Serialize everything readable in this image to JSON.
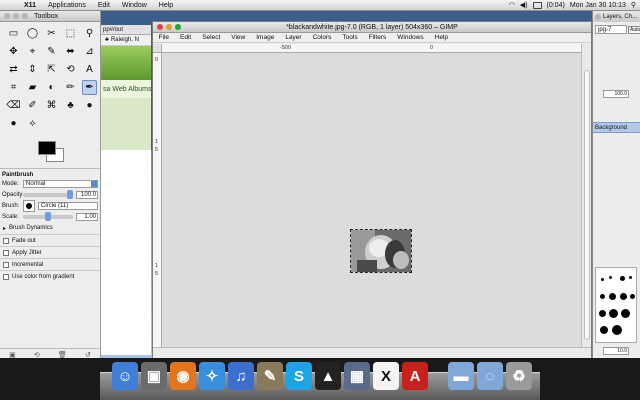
{
  "menubar": {
    "apple": "",
    "app": "X11",
    "items": [
      "Applications",
      "Edit",
      "Window",
      "Help"
    ],
    "clock": "Mon Jan 30  10:13",
    "battery": "(0:04)"
  },
  "toolbox": {
    "title": "Toolbox",
    "tools": [
      "▭",
      "◯",
      "✂",
      "⬚",
      "⚲",
      "✥",
      "⌖",
      "✎",
      "⬌",
      "⊿",
      "⇄",
      "⇕",
      "⇱",
      "⟲",
      "A",
      "⌗",
      "▰",
      "◐",
      "✏",
      "✒",
      "⌫",
      "✐",
      "⌘",
      "♣",
      "●",
      "●",
      "⟡"
    ],
    "options_title": "Paintbrush",
    "mode_label": "Mode:",
    "mode_value": "Normal",
    "opacity_label": "Opacity",
    "opacity_value": "100.0",
    "opacity_level": 1.0,
    "brush_label": "Brush:",
    "brush_value": "Circle (11)",
    "scale_label": "Scale:",
    "scale_value": "1.00",
    "scale_level": 0.5,
    "dynamics_label": "Brush Dynamics",
    "fade_label": "Fade out",
    "jitter_label": "Apply Jitter",
    "incremental_label": "Incremental",
    "gradient_label": "Use color from gradient"
  },
  "browser": {
    "url": "pp#/out",
    "bookmark": "Raleigh, N",
    "album_text": "sa Web Albums"
  },
  "picnik_title": "Picnik",
  "gimp": {
    "title": "*blackandwhite.jpg-7.0 (RGB, 1 layer) 504x360 – GIMP",
    "menu": [
      "File",
      "Edit",
      "Select",
      "View",
      "Image",
      "Layer",
      "Colors",
      "Tools",
      "Filters",
      "Windows",
      "Help"
    ],
    "ruler_top": [
      "-500",
      "0"
    ],
    "ruler_left": [
      "0",
      "1",
      "5",
      "1",
      "5"
    ]
  },
  "rpanel": {
    "title": "Layers, Ch...",
    "combo": "jpg-7",
    "auto": "Auto",
    "opacity_value": "100.0",
    "layer_name": "Background",
    "spacing_value": "10.0"
  },
  "dock": {
    "icons": [
      {
        "name": "finder",
        "glyph": "☺",
        "color": "#3f7fd6"
      },
      {
        "name": "photos",
        "glyph": "▣",
        "color": "#6b6b6b"
      },
      {
        "name": "firefox",
        "glyph": "◉",
        "color": "#e5751c"
      },
      {
        "name": "safari",
        "glyph": "✧",
        "color": "#3a8ee0"
      },
      {
        "name": "itunes",
        "glyph": "♫",
        "color": "#3a6fd0"
      },
      {
        "name": "gimp",
        "glyph": "✎",
        "color": "#8a7a5a"
      },
      {
        "name": "skype",
        "glyph": "S",
        "color": "#1ea4e6"
      },
      {
        "name": "inkscape",
        "glyph": "▲",
        "color": "#222222"
      },
      {
        "name": "preview",
        "glyph": "▦",
        "color": "#5a6a8a"
      },
      {
        "name": "x11",
        "glyph": "X",
        "color": "#f4f4f4"
      },
      {
        "name": "acrobat",
        "glyph": "A",
        "color": "#c8211b"
      },
      {
        "name": "applications-folder",
        "glyph": "▬",
        "color": "#7fa8d6"
      },
      {
        "name": "documents-folder",
        "glyph": "◌",
        "color": "#7fa8d6"
      },
      {
        "name": "trash",
        "glyph": "♻",
        "color": "#9a9a9a"
      }
    ]
  }
}
